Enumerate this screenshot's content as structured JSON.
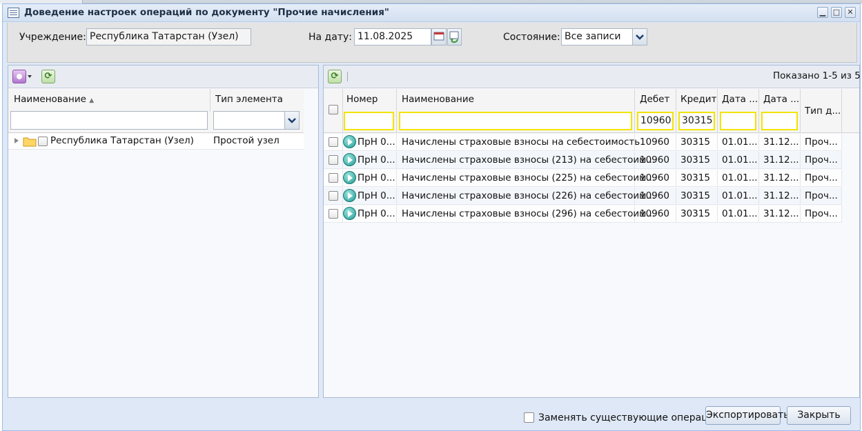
{
  "window": {
    "title": "Доведение настроек операций по документу \"Прочие начисления\""
  },
  "filters": {
    "institution_label": "Учреждение:",
    "institution_value": "Республика Татарстан (Узел)",
    "date_label": "На дату:",
    "date_value": "11.08.2025",
    "state_label": "Состояние:",
    "state_value": "Все записи"
  },
  "tree": {
    "columns": {
      "name": "Наименование",
      "type": "Тип элемента"
    },
    "rows": [
      {
        "name": "Республика Татарстан (Узел)",
        "type": "Простой узел"
      }
    ]
  },
  "grid": {
    "paging": "Показано 1-5 из 5",
    "columns": {
      "number": "Номер",
      "name": "Наименование",
      "debit": "Дебет",
      "credit": "Кредит",
      "date_from": "Дата ...",
      "date_to": "Дата ...",
      "doc_type": "Тип д..."
    },
    "filter_values": {
      "debit": "10960",
      "credit": "30315"
    },
    "rows": [
      {
        "number": "ПрН 0...",
        "name": "Начислены страховые взносы на себестоимость",
        "debit": "10960",
        "credit": "30315",
        "date_from": "01.01...",
        "date_to": "31.12...",
        "doc_type": "Проч..."
      },
      {
        "number": "ПрН 0...",
        "name": "Начислены страховые взносы (213) на себестоим...",
        "debit": "10960",
        "credit": "30315",
        "date_from": "01.01...",
        "date_to": "31.12...",
        "doc_type": "Проч..."
      },
      {
        "number": "ПрН 0...",
        "name": "Начислены страховые взносы (225) на себестоим...",
        "debit": "10960",
        "credit": "30315",
        "date_from": "01.01...",
        "date_to": "31.12...",
        "doc_type": "Проч..."
      },
      {
        "number": "ПрН 0...",
        "name": "Начислены страховые взносы (226) на себестоим...",
        "debit": "10960",
        "credit": "30315",
        "date_from": "01.01...",
        "date_to": "31.12...",
        "doc_type": "Проч..."
      },
      {
        "number": "ПрН 0...",
        "name": "Начислены страховые взносы (296) на себестоим...",
        "debit": "10960",
        "credit": "30315",
        "date_from": "01.01...",
        "date_to": "31.12...",
        "doc_type": "Проч..."
      }
    ]
  },
  "footer": {
    "replace_label": "Заменять существующие операции?",
    "export_label": "Экспортировать",
    "close_label": "Закрыть"
  },
  "icons": {
    "window": "document-list-icon",
    "calendar": "calendar-icon",
    "reset_date": "date-refresh-icon",
    "refresh": "refresh-icon",
    "add": "add-menu-icon",
    "row_action": "play-icon",
    "folder": "folder-icon"
  }
}
